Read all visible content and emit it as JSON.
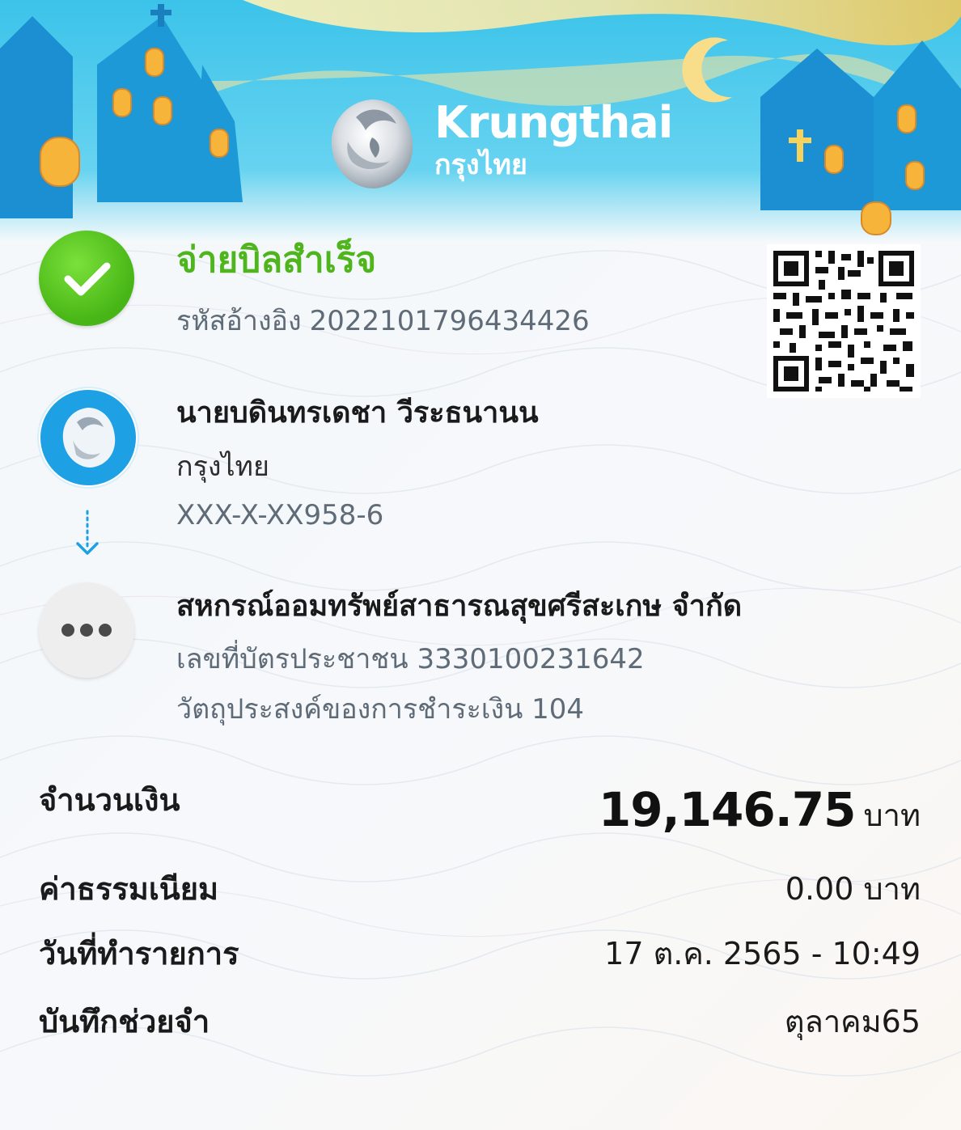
{
  "brand": {
    "name_en": "Krungthai",
    "name_th": "กรุงไทย"
  },
  "status": {
    "title": "จ่ายบิลสำเร็จ",
    "ref_label": "รหัสอ้างอิง",
    "ref_value": "2022101796434426"
  },
  "sender": {
    "name": "นายบดินทรเดชา วีระธนานน",
    "bank": "กรุงไทย",
    "account": "XXX-X-XX958-6"
  },
  "receiver": {
    "name": "สหกรณ์ออมทรัพย์สาธารณสุขศรีสะเกษ จำกัด",
    "id_label": "เลขที่บัตรประชาชน",
    "id_value": "3330100231642",
    "purpose_label": "วัตถุประสงค์ของการชำระเงิน",
    "purpose_value": "104"
  },
  "details": {
    "amount_label": "จำนวนเงิน",
    "amount_value": "19,146.75",
    "amount_unit": "บาท",
    "fee_label": "ค่าธรรมเนียม",
    "fee_value": "0.00 บาท",
    "date_label": "วันที่ทำรายการ",
    "date_value": "17 ต.ค. 2565 - 10:49",
    "memo_label": "บันทึกช่วยจำ",
    "memo_value": "ตุลาคม65"
  },
  "colors": {
    "success": "#4fb51c",
    "brand_blue": "#1ea0e4",
    "banner_sky": "#3cc3ea"
  },
  "icons": {
    "status": "check-circle-icon",
    "sender": "krungthai-bank-icon",
    "arrow": "dotted-arrow-down-icon",
    "receiver": "more-dots-icon",
    "qr": "qr-code-icon"
  }
}
